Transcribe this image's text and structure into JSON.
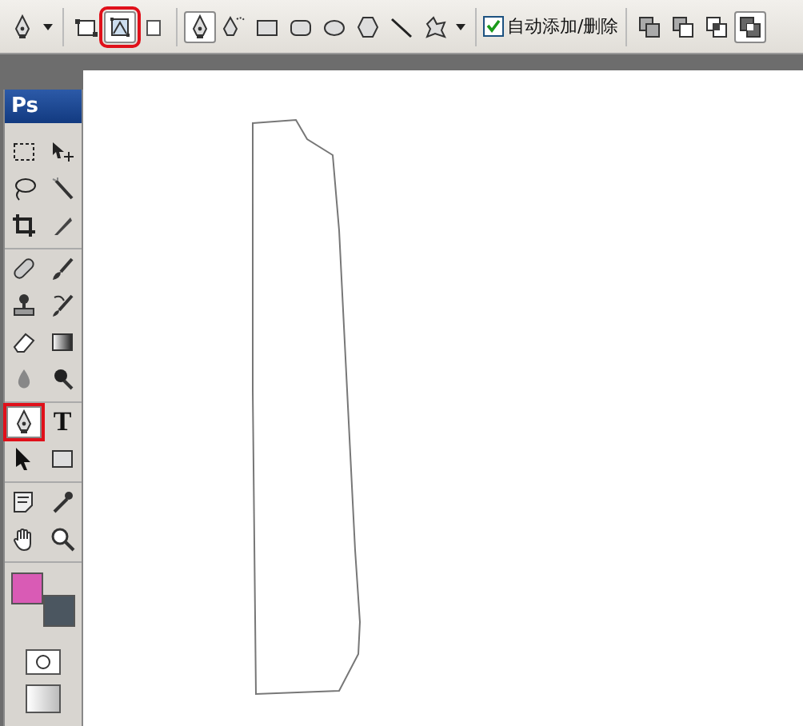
{
  "options_bar": {
    "preset": {
      "kind": "pen"
    },
    "modes": [
      {
        "kind": "shape-layers",
        "selected": false,
        "annotated": false
      },
      {
        "kind": "paths",
        "selected": true,
        "annotated": true
      },
      {
        "kind": "fill-pixels",
        "selected": false,
        "annotated": false
      }
    ],
    "tools": [
      {
        "kind": "pen",
        "selected": true
      },
      {
        "kind": "freeform-pen",
        "selected": false
      },
      {
        "kind": "rectangle",
        "selected": false
      },
      {
        "kind": "rounded-rectangle",
        "selected": false
      },
      {
        "kind": "ellipse",
        "selected": false
      },
      {
        "kind": "polygon",
        "selected": false
      },
      {
        "kind": "line",
        "selected": false
      },
      {
        "kind": "custom-shape",
        "selected": false
      }
    ],
    "auto_add_delete": {
      "label": "自动添加/删除",
      "checked": true
    },
    "path_operations": [
      {
        "kind": "add",
        "selected": false
      },
      {
        "kind": "subtract",
        "selected": false
      },
      {
        "kind": "intersect",
        "selected": false
      },
      {
        "kind": "exclude",
        "selected": true
      }
    ]
  },
  "toolbox": {
    "logo": "Ps",
    "groups": [
      [
        {
          "kind": "marquee",
          "selected": false,
          "annotated": false
        },
        {
          "kind": "move",
          "selected": false,
          "annotated": false
        },
        {
          "kind": "lasso",
          "selected": false,
          "annotated": false
        },
        {
          "kind": "magic-wand",
          "selected": false,
          "annotated": false
        },
        {
          "kind": "crop",
          "selected": false,
          "annotated": false
        },
        {
          "kind": "slice",
          "selected": false,
          "annotated": false
        }
      ],
      [
        {
          "kind": "healing",
          "selected": false,
          "annotated": false
        },
        {
          "kind": "brush",
          "selected": false,
          "annotated": false
        },
        {
          "kind": "stamp",
          "selected": false,
          "annotated": false
        },
        {
          "kind": "history-brush",
          "selected": false,
          "annotated": false
        },
        {
          "kind": "eraser",
          "selected": false,
          "annotated": false
        },
        {
          "kind": "gradient",
          "selected": false,
          "annotated": false
        },
        {
          "kind": "blur",
          "selected": false,
          "annotated": false
        },
        {
          "kind": "dodge",
          "selected": false,
          "annotated": false
        }
      ],
      [
        {
          "kind": "pen",
          "selected": true,
          "annotated": true
        },
        {
          "kind": "type",
          "glyph": "T",
          "selected": false,
          "annotated": false
        },
        {
          "kind": "path-select",
          "selected": false,
          "annotated": false
        },
        {
          "kind": "shape",
          "selected": false,
          "annotated": false
        }
      ],
      [
        {
          "kind": "notes",
          "selected": false,
          "annotated": false
        },
        {
          "kind": "eyedropper",
          "selected": false,
          "annotated": false
        },
        {
          "kind": "hand",
          "selected": false,
          "annotated": false
        },
        {
          "kind": "zoom",
          "selected": false,
          "annotated": false
        }
      ]
    ],
    "foreground": {
      "color": "#d95bb5"
    },
    "background": {
      "color": "#4b5660"
    }
  }
}
